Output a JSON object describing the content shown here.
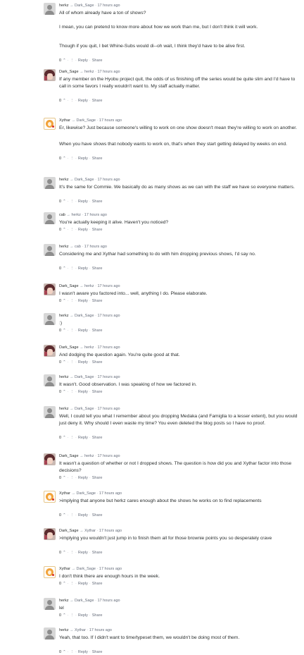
{
  "ui": {
    "separator": "·",
    "arrow": "→",
    "reply_label": "Reply",
    "share_label": "Share",
    "vote_count": "0",
    "upvote_glyph": "⌃",
    "downvote_glyph": "⋮"
  },
  "comments": [
    {
      "author": "herkz",
      "parent": "Dark_Sage",
      "time": "17 hours ago",
      "avatar_icon": "default-avatar",
      "paragraphs": [
        "All of whom already have a ton of shows?",
        "I mean, you can pretend to know more about how we work than me, but I don't think it will work.",
        "Though if you quit, I bet Whine-Subs would di--oh wait, I think they'd have to be alive first."
      ]
    },
    {
      "author": "Dark_Sage",
      "parent": "herkz",
      "time": "17 hours ago",
      "avatar_icon": "anime-avatar",
      "paragraphs": [
        "If any member on the Hyobu project quit, the odds of us finishing off the series would be quite slim and I'd have to call in some favors I really wouldn't want to. My staff actually matter."
      ]
    },
    {
      "author": "Xythar",
      "parent": "Dark_Sage",
      "time": "17 hours ago",
      "avatar_icon": "xythar-avatar",
      "paragraphs": [
        "Er, likewise? Just because someone's willing to work on one show doesn't mean they're willing to work on another.",
        "When you have shows that nobody wants to work on, that's when they start getting delayed by weeks on end."
      ]
    },
    {
      "author": "herkz",
      "parent": "Dark_Sage",
      "time": "17 hours ago",
      "avatar_icon": "default-avatar",
      "paragraphs": [
        "It's the same for Commie. We basically do as many shows as we can with the staff we have so everyone matters."
      ]
    },
    {
      "author": "cab",
      "parent": "herkz",
      "time": "17 hours ago",
      "avatar_icon": "default-avatar",
      "paragraphs": [
        "You're actually keeping it alive. Haven't you noticed?"
      ]
    },
    {
      "author": "herkz",
      "parent": "cab",
      "time": "17 hours ago",
      "avatar_icon": "default-avatar",
      "paragraphs": [
        "Considering me and Xythar had something to do with him dropping previous shows, I'd say no."
      ]
    },
    {
      "author": "Dark_Sage",
      "parent": "herkz",
      "time": "17 hours ago",
      "avatar_icon": "anime-avatar",
      "paragraphs": [
        "I wasn't aware you factored into... well, anything I do. Please elaborate."
      ]
    },
    {
      "author": "herkz",
      "parent": "Dark_Sage",
      "time": "17 hours ago",
      "avatar_icon": "default-avatar",
      "paragraphs": [
        ":)"
      ]
    },
    {
      "author": "Dark_Sage",
      "parent": "herkz",
      "time": "17 hours ago",
      "avatar_icon": "anime-avatar",
      "paragraphs": [
        "And dodging the question again. You're quite good at that."
      ]
    },
    {
      "author": "herkz",
      "parent": "Dark_Sage",
      "time": "17 hours ago",
      "avatar_icon": "default-avatar",
      "paragraphs": [
        "It wasn't. Good observation. I was speaking of how we factored in."
      ]
    },
    {
      "author": "herkz",
      "parent": "Dark_Sage",
      "time": "17 hours ago",
      "avatar_icon": "default-avatar",
      "paragraphs": [
        "Well, I could tell you what I remember about you dropping Medaka (and Famiglia to a lesser extent), but you would just deny it. Why should I even waste my time? You even deleted the blog posts so I have no proof."
      ]
    },
    {
      "author": "Dark_Sage",
      "parent": "herkz",
      "time": "17 hours ago",
      "avatar_icon": "anime-avatar",
      "paragraphs": [
        "It wasn't a question of whether or not I dropped shows. The question is how did you and Xythar factor into those decisions?"
      ]
    },
    {
      "author": "Xythar",
      "parent": "Dark_Sage",
      "time": "17 hours ago",
      "avatar_icon": "xythar-avatar",
      "paragraphs": [
        ">implying that anyone but herkz cares enough about the shows he works on to find replacements"
      ]
    },
    {
      "author": "Dark_Sage",
      "parent": "Xythar",
      "time": "17 hours ago",
      "avatar_icon": "anime-avatar",
      "paragraphs": [
        ">implying you wouldn't just jump in to finish them all for those brownie points you so desperately crave"
      ]
    },
    {
      "author": "Xythar",
      "parent": "Dark_Sage",
      "time": "17 hours ago",
      "avatar_icon": "xythar-avatar",
      "paragraphs": [
        "I don't think there are enough hours in the week."
      ]
    },
    {
      "author": "herkz",
      "parent": "Dark_Sage",
      "time": "17 hours ago",
      "avatar_icon": "default-avatar",
      "paragraphs": [
        "lel"
      ]
    },
    {
      "author": "herkz",
      "parent": "Xythar",
      "time": "17 hours ago",
      "avatar_icon": "default-avatar",
      "paragraphs": [
        "Yeah, that too. If I didn't want to time/typeset them, we wouldn't be doing most of them."
      ]
    }
  ]
}
